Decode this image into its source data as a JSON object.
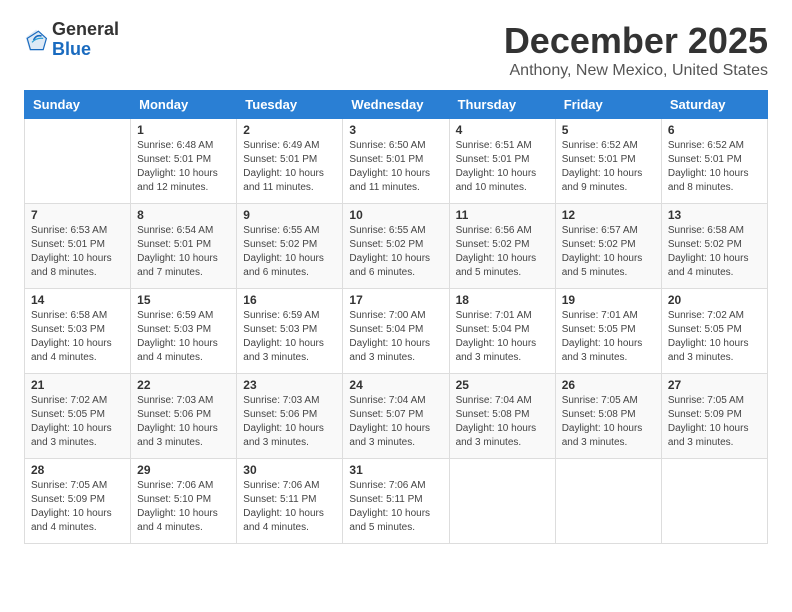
{
  "logo": {
    "general": "General",
    "blue": "Blue"
  },
  "title": "December 2025",
  "location": "Anthony, New Mexico, United States",
  "days_header": [
    "Sunday",
    "Monday",
    "Tuesday",
    "Wednesday",
    "Thursday",
    "Friday",
    "Saturday"
  ],
  "weeks": [
    [
      {
        "day": "",
        "info": ""
      },
      {
        "day": "1",
        "info": "Sunrise: 6:48 AM\nSunset: 5:01 PM\nDaylight: 10 hours\nand 12 minutes."
      },
      {
        "day": "2",
        "info": "Sunrise: 6:49 AM\nSunset: 5:01 PM\nDaylight: 10 hours\nand 11 minutes."
      },
      {
        "day": "3",
        "info": "Sunrise: 6:50 AM\nSunset: 5:01 PM\nDaylight: 10 hours\nand 11 minutes."
      },
      {
        "day": "4",
        "info": "Sunrise: 6:51 AM\nSunset: 5:01 PM\nDaylight: 10 hours\nand 10 minutes."
      },
      {
        "day": "5",
        "info": "Sunrise: 6:52 AM\nSunset: 5:01 PM\nDaylight: 10 hours\nand 9 minutes."
      },
      {
        "day": "6",
        "info": "Sunrise: 6:52 AM\nSunset: 5:01 PM\nDaylight: 10 hours\nand 8 minutes."
      }
    ],
    [
      {
        "day": "7",
        "info": "Sunrise: 6:53 AM\nSunset: 5:01 PM\nDaylight: 10 hours\nand 8 minutes."
      },
      {
        "day": "8",
        "info": "Sunrise: 6:54 AM\nSunset: 5:01 PM\nDaylight: 10 hours\nand 7 minutes."
      },
      {
        "day": "9",
        "info": "Sunrise: 6:55 AM\nSunset: 5:02 PM\nDaylight: 10 hours\nand 6 minutes."
      },
      {
        "day": "10",
        "info": "Sunrise: 6:55 AM\nSunset: 5:02 PM\nDaylight: 10 hours\nand 6 minutes."
      },
      {
        "day": "11",
        "info": "Sunrise: 6:56 AM\nSunset: 5:02 PM\nDaylight: 10 hours\nand 5 minutes."
      },
      {
        "day": "12",
        "info": "Sunrise: 6:57 AM\nSunset: 5:02 PM\nDaylight: 10 hours\nand 5 minutes."
      },
      {
        "day": "13",
        "info": "Sunrise: 6:58 AM\nSunset: 5:02 PM\nDaylight: 10 hours\nand 4 minutes."
      }
    ],
    [
      {
        "day": "14",
        "info": "Sunrise: 6:58 AM\nSunset: 5:03 PM\nDaylight: 10 hours\nand 4 minutes."
      },
      {
        "day": "15",
        "info": "Sunrise: 6:59 AM\nSunset: 5:03 PM\nDaylight: 10 hours\nand 4 minutes."
      },
      {
        "day": "16",
        "info": "Sunrise: 6:59 AM\nSunset: 5:03 PM\nDaylight: 10 hours\nand 3 minutes."
      },
      {
        "day": "17",
        "info": "Sunrise: 7:00 AM\nSunset: 5:04 PM\nDaylight: 10 hours\nand 3 minutes."
      },
      {
        "day": "18",
        "info": "Sunrise: 7:01 AM\nSunset: 5:04 PM\nDaylight: 10 hours\nand 3 minutes."
      },
      {
        "day": "19",
        "info": "Sunrise: 7:01 AM\nSunset: 5:05 PM\nDaylight: 10 hours\nand 3 minutes."
      },
      {
        "day": "20",
        "info": "Sunrise: 7:02 AM\nSunset: 5:05 PM\nDaylight: 10 hours\nand 3 minutes."
      }
    ],
    [
      {
        "day": "21",
        "info": "Sunrise: 7:02 AM\nSunset: 5:05 PM\nDaylight: 10 hours\nand 3 minutes."
      },
      {
        "day": "22",
        "info": "Sunrise: 7:03 AM\nSunset: 5:06 PM\nDaylight: 10 hours\nand 3 minutes."
      },
      {
        "day": "23",
        "info": "Sunrise: 7:03 AM\nSunset: 5:06 PM\nDaylight: 10 hours\nand 3 minutes."
      },
      {
        "day": "24",
        "info": "Sunrise: 7:04 AM\nSunset: 5:07 PM\nDaylight: 10 hours\nand 3 minutes."
      },
      {
        "day": "25",
        "info": "Sunrise: 7:04 AM\nSunset: 5:08 PM\nDaylight: 10 hours\nand 3 minutes."
      },
      {
        "day": "26",
        "info": "Sunrise: 7:05 AM\nSunset: 5:08 PM\nDaylight: 10 hours\nand 3 minutes."
      },
      {
        "day": "27",
        "info": "Sunrise: 7:05 AM\nSunset: 5:09 PM\nDaylight: 10 hours\nand 3 minutes."
      }
    ],
    [
      {
        "day": "28",
        "info": "Sunrise: 7:05 AM\nSunset: 5:09 PM\nDaylight: 10 hours\nand 4 minutes."
      },
      {
        "day": "29",
        "info": "Sunrise: 7:06 AM\nSunset: 5:10 PM\nDaylight: 10 hours\nand 4 minutes."
      },
      {
        "day": "30",
        "info": "Sunrise: 7:06 AM\nSunset: 5:11 PM\nDaylight: 10 hours\nand 4 minutes."
      },
      {
        "day": "31",
        "info": "Sunrise: 7:06 AM\nSunset: 5:11 PM\nDaylight: 10 hours\nand 5 minutes."
      },
      {
        "day": "",
        "info": ""
      },
      {
        "day": "",
        "info": ""
      },
      {
        "day": "",
        "info": ""
      }
    ]
  ]
}
